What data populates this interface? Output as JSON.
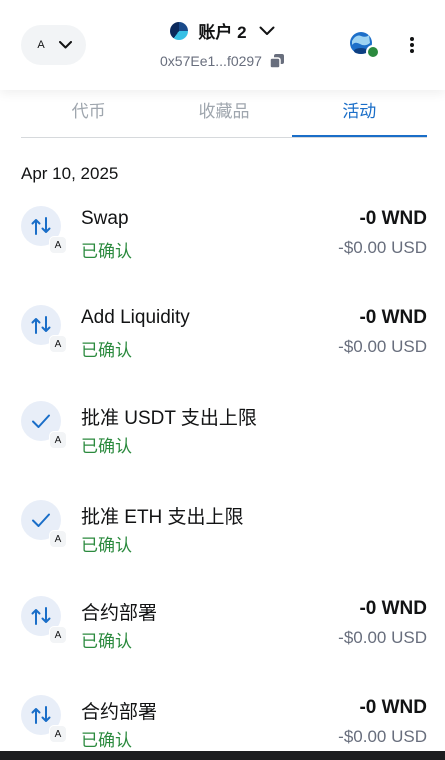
{
  "header": {
    "network_badge": "A",
    "account_name": "账户 2",
    "address": "0x57Ee1...f0297"
  },
  "tabs": [
    {
      "label": "代币"
    },
    {
      "label": "收藏品"
    },
    {
      "label": "活动"
    }
  ],
  "active_tab": "活动",
  "activity": {
    "date": "Apr 10, 2025",
    "items": [
      {
        "title": "Swap",
        "status": "已确认",
        "amount": "-0 WND",
        "fiat": "-$0.00 USD",
        "icon": "swap-icon",
        "badge": "A"
      },
      {
        "title": "Add Liquidity",
        "status": "已确认",
        "amount": "-0 WND",
        "fiat": "-$0.00 USD",
        "icon": "swap-icon",
        "badge": "A"
      },
      {
        "title": "批准 USDT 支出上限",
        "status": "已确认",
        "amount": "",
        "fiat": "",
        "icon": "check-icon",
        "badge": "A"
      },
      {
        "title": "批准 ETH 支出上限",
        "status": "已确认",
        "amount": "",
        "fiat": "",
        "icon": "check-icon",
        "badge": "A"
      },
      {
        "title": "合约部署",
        "status": "已确认",
        "amount": "-0 WND",
        "fiat": "-$0.00 USD",
        "icon": "swap-icon",
        "badge": "A"
      },
      {
        "title": "合约部署",
        "status": "已确认",
        "amount": "-0 WND",
        "fiat": "-$0.00 USD",
        "icon": "swap-icon",
        "badge": "A"
      }
    ]
  },
  "colors": {
    "accent": "#1a6ec8",
    "success": "#2b8a3e",
    "muted": "#686e7d"
  }
}
